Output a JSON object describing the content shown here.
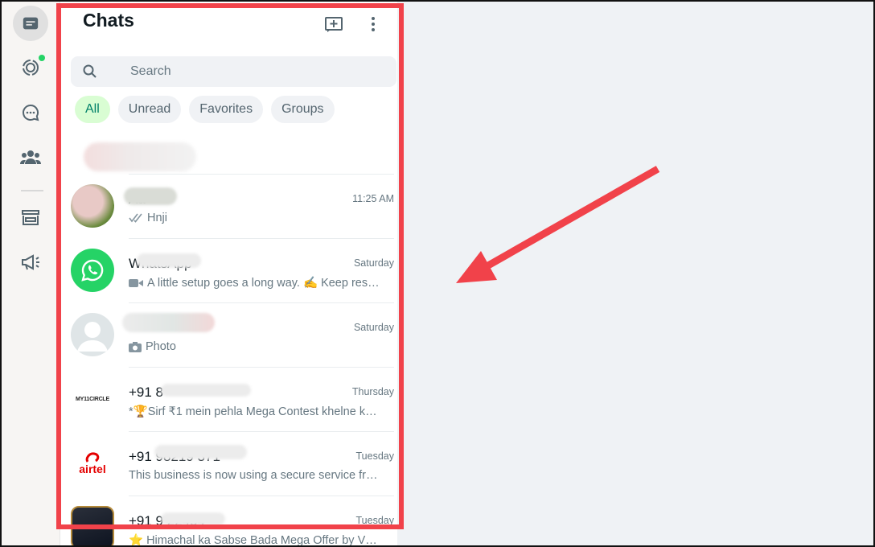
{
  "header": {
    "title": "Chats"
  },
  "search": {
    "placeholder": "Search"
  },
  "filters": [
    "All",
    "Unread",
    "Favorites",
    "Groups"
  ],
  "chats": [
    {
      "name": "Aa",
      "time": "11:25 AM",
      "message": "Hnji",
      "msg_icon": "double-check-icon"
    },
    {
      "name": "WhatsApp",
      "time": "Saturday",
      "message": "A little setup goes a long way. ✍️ Keep res…",
      "msg_icon": "video-icon"
    },
    {
      "name": "",
      "time": "Saturday",
      "message": "Photo",
      "msg_icon": "camera-icon"
    },
    {
      "name": "+91 8",
      "time": "Thursday",
      "message": "*🏆Sirf ₹1 mein pehla Mega Contest khelne k…",
      "logo": "MY11CIRCLE"
    },
    {
      "name": "+91 98219 371",
      "time": "Tuesday",
      "message": "This business is now using a secure service fr…",
      "logo": "airtel"
    },
    {
      "name": "+91 9 22454",
      "time": "Tuesday",
      "message": "⭐ Himachal ka Sabse Bada Mega Offer by V…"
    }
  ],
  "colors": {
    "accent": "#25d366",
    "highlight": "#f1424a",
    "chip_active_bg": "#d9fdd3"
  }
}
